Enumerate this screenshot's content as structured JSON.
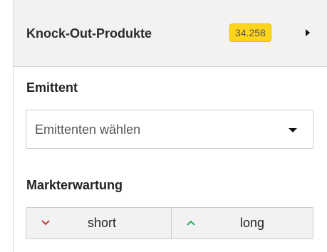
{
  "header": {
    "title": "Knock-Out-Produkte",
    "count": "34.258",
    "badge_color": "#ffd51c",
    "expand_icon": "arrow-right-icon"
  },
  "issuer": {
    "label": "Emittent",
    "placeholder": "Emittenten wählen",
    "dropdown_icon": "caret-down-icon"
  },
  "market_expectation": {
    "label": "Markterwartung",
    "short_label": "short",
    "short_icon": "chevron-down-icon",
    "short_icon_color": "#c0392b",
    "long_label": "long",
    "long_icon": "chevron-up-icon",
    "long_icon_color": "#27ae60"
  }
}
